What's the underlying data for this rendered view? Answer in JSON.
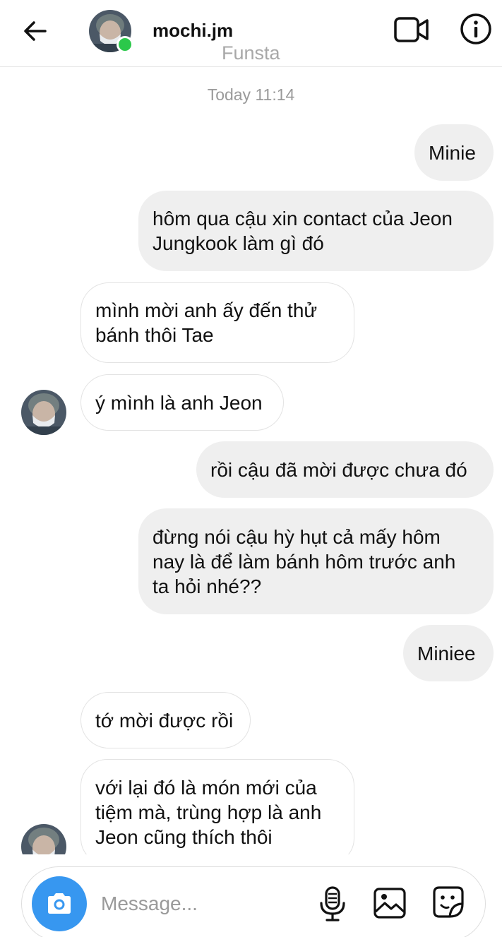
{
  "header": {
    "username": "mochi.jm",
    "subtitle": "Funsta",
    "back_icon": "arrow-left-icon",
    "video_icon": "video-camera-icon",
    "info_icon": "info-icon"
  },
  "thread": {
    "timestamp": "Today 11:14",
    "messages": [
      {
        "direction": "outgoing",
        "text": "Minie"
      },
      {
        "direction": "outgoing",
        "text": "hôm qua cậu xin contact của Jeon\nJungkook làm gì đó"
      },
      {
        "direction": "incoming",
        "text": "mình mời anh ấy đến thử\nbánh thôi Tae"
      },
      {
        "direction": "incoming",
        "text": "ý mình là anh Jeon"
      },
      {
        "direction": "outgoing",
        "text": "rồi cậu đã mời được chưa đó"
      },
      {
        "direction": "outgoing",
        "text": "đừng nói cậu hỳ hụt cả mấy hôm\nnay là để làm bánh hôm trước anh\nta hỏi nhé??"
      },
      {
        "direction": "outgoing",
        "text": "Miniee"
      },
      {
        "direction": "incoming",
        "text": "tớ mời được rồi"
      },
      {
        "direction": "incoming",
        "text": "với lại đó là món mới của\ntiệm mà, trùng hợp là anh\nJeon cũng thích thôi"
      }
    ]
  },
  "composer": {
    "placeholder": "Message...",
    "camera_icon": "camera-icon",
    "mic_icon": "microphone-icon",
    "gallery_icon": "image-icon",
    "sticker_icon": "sticker-icon"
  },
  "colors": {
    "online": "#2bc84a",
    "camera_button": "#3797f0",
    "outgoing_bubble": "#efefef"
  }
}
